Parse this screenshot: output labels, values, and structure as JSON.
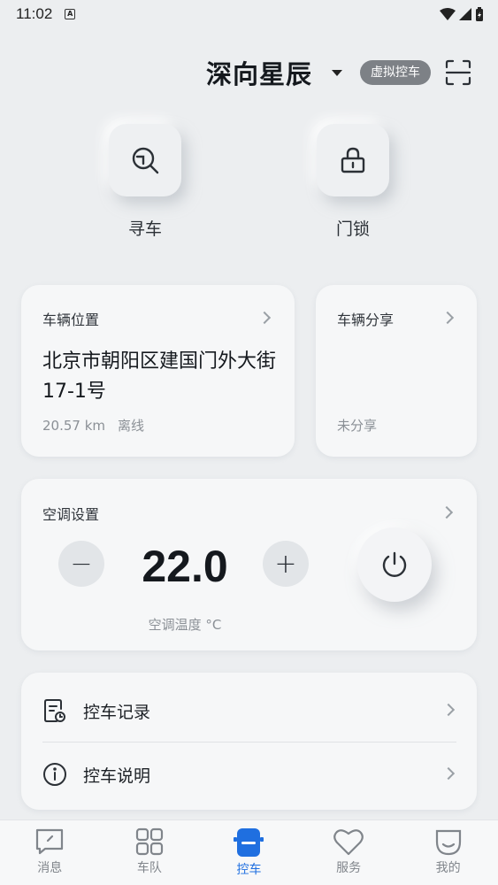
{
  "status_bar": {
    "time": "11:02",
    "a_badge": "A"
  },
  "header": {
    "vehicle_name": "深向星辰",
    "virtual_badge": "虚拟控车"
  },
  "quick_actions": [
    {
      "label": "寻车",
      "icon": "find-car-icon"
    },
    {
      "label": "门锁",
      "icon": "lock-icon"
    }
  ],
  "location_card": {
    "title": "车辆位置",
    "address": "北京市朝阳区建国门外大街17-1号",
    "distance": "20.57 km",
    "status": "离线"
  },
  "share_card": {
    "title": "车辆分享",
    "status": "未分享"
  },
  "ac_card": {
    "title": "空调设置",
    "minus": "−",
    "plus": "+",
    "temperature": "22.0",
    "caption": "空调温度 °C"
  },
  "list_items": [
    {
      "label": "控车记录",
      "icon": "record-icon"
    },
    {
      "label": "控车说明",
      "icon": "info-icon"
    }
  ],
  "bottom_nav": [
    {
      "label": "消息",
      "icon": "message-icon"
    },
    {
      "label": "车队",
      "icon": "fleet-icon"
    },
    {
      "label": "控车",
      "icon": "car-control-icon",
      "active": true
    },
    {
      "label": "服务",
      "icon": "heart-icon"
    },
    {
      "label": "我的",
      "icon": "profile-icon"
    }
  ],
  "colors": {
    "accent": "#1f6fe0",
    "background": "#eceef0",
    "badge": "#7d8186"
  }
}
